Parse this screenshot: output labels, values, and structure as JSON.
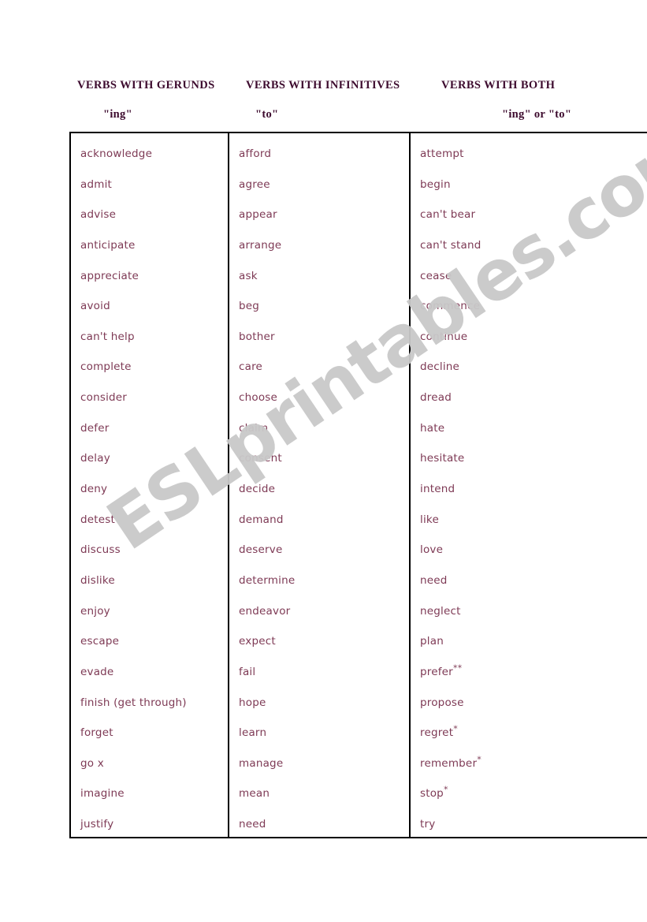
{
  "watermark": {
    "text": "ESLprintables.com",
    "color": "#c9c9c9"
  },
  "theme": {
    "header_color": "#3d0b2e",
    "body_text_color": "#7e3a55",
    "border_color": "#000000",
    "page_background": "#ffffff"
  },
  "table": {
    "columns": [
      {
        "header": "VERBS WITH GERUNDS",
        "subheader": "\"ing\"",
        "verbs": [
          "acknowledge",
          "admit",
          "advise",
          "anticipate",
          "appreciate",
          "avoid",
          "can't help",
          "complete",
          "consider",
          "defer",
          "delay",
          "deny",
          "detest",
          "discuss",
          "dislike",
          "enjoy",
          "escape",
          "evade",
          "finish  (get through)",
          "forget",
          "go  x",
          "imagine",
          "justify"
        ]
      },
      {
        "header": "VERBS WITH INFINITIVES",
        "subheader": "\"to\"",
        "verbs": [
          "afford",
          "agree",
          "appear",
          "arrange",
          "ask",
          "beg",
          "bother",
          "care",
          "choose",
          "claim",
          "consent",
          "decide",
          "demand",
          "deserve",
          "determine",
          "endeavor",
          "expect",
          "fail",
          "hope",
          "learn",
          "manage",
          "mean",
          "need"
        ]
      },
      {
        "header": "VERBS WITH BOTH",
        "subheader": "\"ing\" or \"to\"",
        "verbs": [
          "attempt",
          "begin",
          "can't bear",
          "can't stand",
          "cease",
          "commence",
          "continue",
          "decline",
          "dread",
          "hate",
          "hesitate",
          "intend",
          "like",
          "love",
          "need",
          "neglect",
          "plan",
          "prefer**",
          "propose",
          "regret*",
          "remember*",
          "stop*",
          "try"
        ]
      }
    ]
  }
}
